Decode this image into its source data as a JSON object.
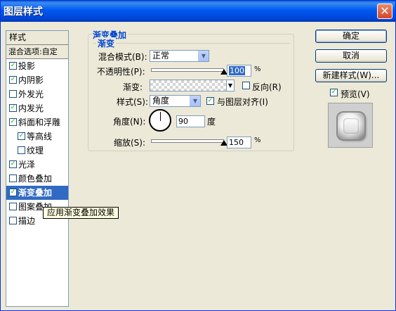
{
  "window": {
    "title": "图层样式",
    "close_glyph": "✕"
  },
  "style_list": {
    "header": "样式",
    "blend_options": "混合选项:自定",
    "items": [
      {
        "label": "投影",
        "checked": true
      },
      {
        "label": "内阴影",
        "checked": true
      },
      {
        "label": "外发光",
        "checked": false
      },
      {
        "label": "内发光",
        "checked": true
      },
      {
        "label": "斜面和浮雕",
        "checked": true
      },
      {
        "label": "等高线",
        "checked": true,
        "indent": true
      },
      {
        "label": "纹理",
        "checked": false,
        "indent": true
      },
      {
        "label": "光泽",
        "checked": true
      },
      {
        "label": "颜色叠加",
        "checked": false
      },
      {
        "label": "渐变叠加",
        "checked": true,
        "selected": true
      },
      {
        "label": "图案叠加",
        "checked": false
      },
      {
        "label": "描边",
        "checked": false
      }
    ],
    "tooltip": "应用渐变叠加效果"
  },
  "panel": {
    "outer_title": "渐变叠加",
    "inner_title": "渐变",
    "blend_mode_label": "混合模式(B):",
    "blend_mode_value": "正常",
    "opacity_label": "不透明性(P):",
    "opacity_value": "100",
    "opacity_unit": "%",
    "opacity_fraction": 1.0,
    "gradient_label": "渐变:",
    "reverse_label": "反向(R)",
    "reverse_checked": false,
    "style_label": "样式(S):",
    "style_value": "角度",
    "align_label": "与图层对齐(I)",
    "align_checked": true,
    "angle_label": "角度(N):",
    "angle_value": "90",
    "angle_unit": "度",
    "scale_label": "缩放(S):",
    "scale_value": "150",
    "scale_unit": "%",
    "scale_fraction": 1.0
  },
  "buttons": {
    "ok": "确定",
    "cancel": "取消",
    "new_style": "新建样式(W)...",
    "preview_label": "预览(V)",
    "preview_checked": true
  },
  "icons": {
    "check": "✓",
    "dropdown": "▼"
  },
  "colors": {
    "selection": "#316ac5",
    "title_blue": "#0046d5",
    "checkmark": "#21a121"
  }
}
